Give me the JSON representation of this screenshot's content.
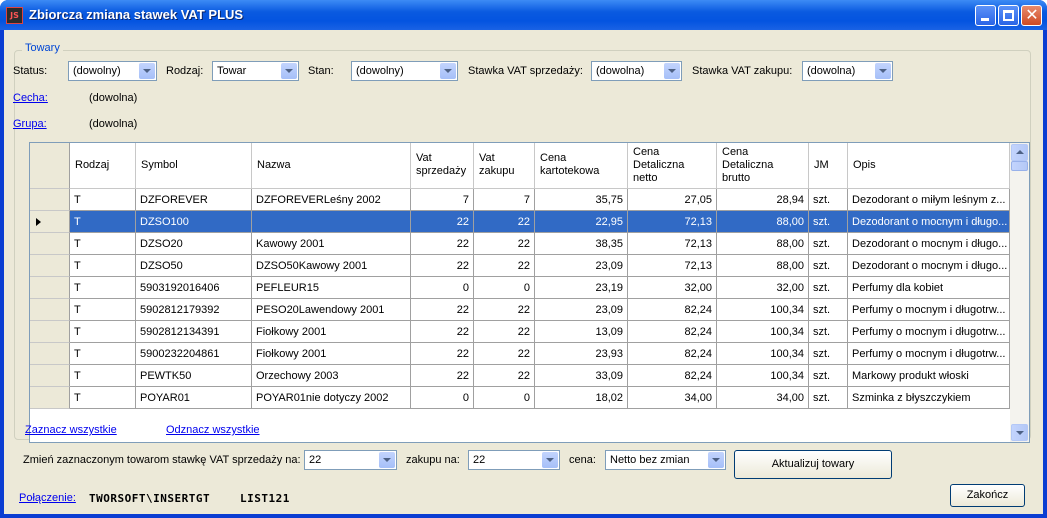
{
  "window": {
    "title": "Zbiorcza zmiana stawek VAT PLUS",
    "app_icon": "JS"
  },
  "group": {
    "title": "Towary"
  },
  "filters": {
    "status_label": "Status:",
    "status_value": "(dowolny)",
    "rodzaj_label": "Rodzaj:",
    "rodzaj_value": "Towar",
    "stan_label": "Stan:",
    "stan_value": "(dowolny)",
    "vat_sprzedazy_label": "Stawka VAT sprzedaży:",
    "vat_sprzedazy_value": "(dowolna)",
    "vat_zakupu_label": "Stawka VAT zakupu:",
    "vat_zakupu_value": "(dowolna)",
    "cecha_link": "Cecha:",
    "cecha_value": "(dowolna)",
    "grupa_link": "Grupa:",
    "grupa_value": "(dowolna)"
  },
  "table": {
    "headers": {
      "rodzaj": "Rodzaj",
      "symbol": "Symbol",
      "nazwa": "Nazwa",
      "vat_s1": "Vat",
      "vat_s2": "sprzedaży",
      "vat_z1": "Vat",
      "vat_z2": "zakupu",
      "cena1": "Cena",
      "cena2": "kartotekowa",
      "cdn1": "Cena",
      "cdn2": "Detaliczna",
      "cdn3": "netto",
      "cdb1": "Cena",
      "cdb2": "Detaliczna",
      "cdb3": "brutto",
      "jm": "JM",
      "opis": "Opis"
    },
    "selected_row": 1,
    "rows": [
      [
        "T",
        "DZFOREVER",
        "DZFOREVERLeśny 2002",
        "7",
        "7",
        "35,75",
        "27,05",
        "28,94",
        "szt.",
        "Dezodorant o miłym leśnym z..."
      ],
      [
        "T",
        "DZSO100",
        "",
        "22",
        "22",
        "22,95",
        "72,13",
        "88,00",
        "szt.",
        "Dezodorant o mocnym i długo..."
      ],
      [
        "T",
        "DZSO20",
        "Kawowy 2001",
        "22",
        "22",
        "38,35",
        "72,13",
        "88,00",
        "szt.",
        "Dezodorant o mocnym i długo..."
      ],
      [
        "T",
        "DZSO50",
        "DZSO50Kawowy 2001",
        "22",
        "22",
        "23,09",
        "72,13",
        "88,00",
        "szt.",
        "Dezodorant o mocnym i długo..."
      ],
      [
        "T",
        "5903192016406",
        "PEFLEUR15",
        "0",
        "0",
        "23,19",
        "32,00",
        "32,00",
        "szt.",
        "Perfumy dla kobiet"
      ],
      [
        "T",
        "5902812179392",
        "PESO20Lawendowy 2001",
        "22",
        "22",
        "23,09",
        "82,24",
        "100,34",
        "szt.",
        "Perfumy o mocnym i długotrw..."
      ],
      [
        "T",
        "5902812134391",
        "Fiołkowy 2001",
        "22",
        "22",
        "13,09",
        "82,24",
        "100,34",
        "szt.",
        "Perfumy o mocnym i długotrw..."
      ],
      [
        "T",
        "5900232204861",
        "Fiołkowy 2001",
        "22",
        "22",
        "23,93",
        "82,24",
        "100,34",
        "szt.",
        "Perfumy o mocnym i długotrw..."
      ],
      [
        "T",
        "PEWTK50",
        "Orzechowy 2003",
        "22",
        "22",
        "33,09",
        "82,24",
        "100,34",
        "szt.",
        "Markowy produkt włoski"
      ],
      [
        "T",
        "POYAR01",
        "POYAR01nie dotyczy 2002",
        "0",
        "0",
        "18,02",
        "34,00",
        "34,00",
        "szt.",
        "Szminka z błyszczykiem"
      ]
    ]
  },
  "actions": {
    "select_all": "Zaznacz wszystkie",
    "deselect_all": "Odznacz wszystkie",
    "change_label": "Zmień zaznaczonym towarom stawkę VAT sprzedaży na:",
    "sprzedazy_value": "22",
    "zakupu_label": "zakupu na:",
    "zakupu_value": "22",
    "cena_label": "cena:",
    "cena_value": "Netto bez zmian",
    "update_button": "Aktualizuj towary"
  },
  "footer": {
    "connection_link": "Połączenie:",
    "server": "TWORSOFT\\INSERTGT",
    "database": "LIST121",
    "close_button": "Zakończ"
  }
}
